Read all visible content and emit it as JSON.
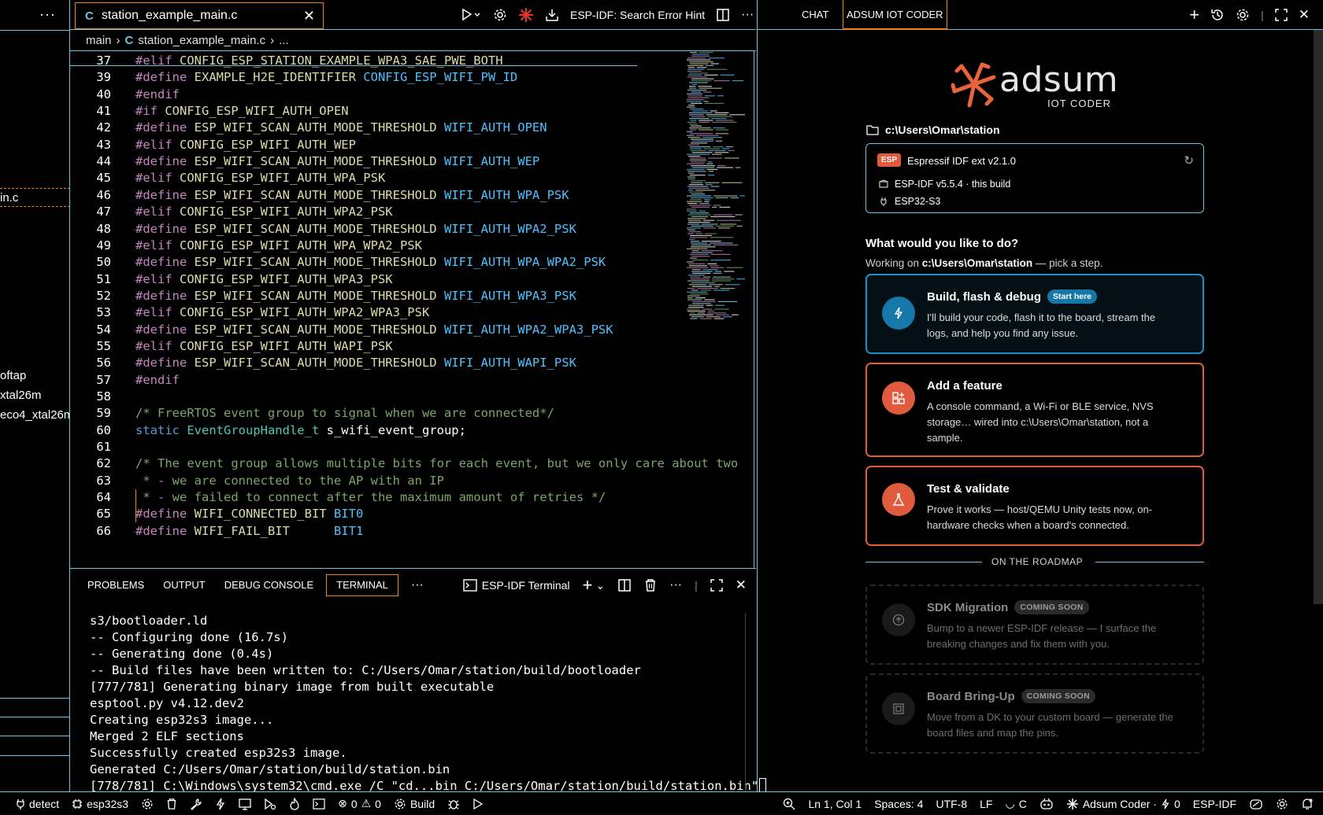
{
  "sidebar": {
    "items": [
      {
        "label": "in.c",
        "active": true
      },
      {
        "label": "oftap"
      },
      {
        "label": "xtal26m"
      },
      {
        "label": "eco4_xtal26m"
      }
    ]
  },
  "editor": {
    "tab": {
      "lang_badge": "C",
      "filename": "station_example_main.c"
    },
    "toolbar": {
      "search_error_hint": "ESP-IDF: Search Error Hint"
    },
    "breadcrumb": {
      "folder": "main",
      "file": "station_example_main.c",
      "more": "..."
    },
    "lines": [
      {
        "n": "37",
        "tokens": [
          [
            "pp",
            "#elif "
          ],
          [
            "id",
            "CONFIG_ESP_STATION_EXAMPLE_WPA3_SAE_PWE_BOTH"
          ]
        ]
      },
      {
        "n": "39",
        "tokens": [
          [
            "pp",
            "#define "
          ],
          [
            "id",
            "EXAMPLE_H2E_IDENTIFIER "
          ],
          [
            "mac",
            "CONFIG_ESP_WIFI_PW_ID"
          ]
        ]
      },
      {
        "n": "40",
        "tokens": [
          [
            "pp",
            "#endif"
          ]
        ]
      },
      {
        "n": "41",
        "tokens": [
          [
            "pp",
            "#if "
          ],
          [
            "id",
            "CONFIG_ESP_WIFI_AUTH_OPEN"
          ]
        ]
      },
      {
        "n": "42",
        "tokens": [
          [
            "pp",
            "#define "
          ],
          [
            "id",
            "ESP_WIFI_SCAN_AUTH_MODE_THRESHOLD "
          ],
          [
            "mac",
            "WIFI_AUTH_OPEN"
          ]
        ]
      },
      {
        "n": "43",
        "tokens": [
          [
            "pp",
            "#elif "
          ],
          [
            "id",
            "CONFIG_ESP_WIFI_AUTH_WEP"
          ]
        ]
      },
      {
        "n": "44",
        "tokens": [
          [
            "pp",
            "#define "
          ],
          [
            "id",
            "ESP_WIFI_SCAN_AUTH_MODE_THRESHOLD "
          ],
          [
            "mac",
            "WIFI_AUTH_WEP"
          ]
        ]
      },
      {
        "n": "45",
        "tokens": [
          [
            "pp",
            "#elif "
          ],
          [
            "id",
            "CONFIG_ESP_WIFI_AUTH_WPA_PSK"
          ]
        ]
      },
      {
        "n": "46",
        "tokens": [
          [
            "pp",
            "#define "
          ],
          [
            "id",
            "ESP_WIFI_SCAN_AUTH_MODE_THRESHOLD "
          ],
          [
            "mac",
            "WIFI_AUTH_WPA_PSK"
          ]
        ]
      },
      {
        "n": "47",
        "tokens": [
          [
            "pp",
            "#elif "
          ],
          [
            "id",
            "CONFIG_ESP_WIFI_AUTH_WPA2_PSK"
          ]
        ]
      },
      {
        "n": "48",
        "tokens": [
          [
            "pp",
            "#define "
          ],
          [
            "id",
            "ESP_WIFI_SCAN_AUTH_MODE_THRESHOLD "
          ],
          [
            "mac",
            "WIFI_AUTH_WPA2_PSK"
          ]
        ]
      },
      {
        "n": "49",
        "tokens": [
          [
            "pp",
            "#elif "
          ],
          [
            "id",
            "CONFIG_ESP_WIFI_AUTH_WPA_WPA2_PSK"
          ]
        ]
      },
      {
        "n": "50",
        "tokens": [
          [
            "pp",
            "#define "
          ],
          [
            "id",
            "ESP_WIFI_SCAN_AUTH_MODE_THRESHOLD "
          ],
          [
            "mac",
            "WIFI_AUTH_WPA_WPA2_PSK"
          ]
        ]
      },
      {
        "n": "51",
        "tokens": [
          [
            "pp",
            "#elif "
          ],
          [
            "id",
            "CONFIG_ESP_WIFI_AUTH_WPA3_PSK"
          ]
        ]
      },
      {
        "n": "52",
        "tokens": [
          [
            "pp",
            "#define "
          ],
          [
            "id",
            "ESP_WIFI_SCAN_AUTH_MODE_THRESHOLD "
          ],
          [
            "mac",
            "WIFI_AUTH_WPA3_PSK"
          ]
        ]
      },
      {
        "n": "53",
        "tokens": [
          [
            "pp",
            "#elif "
          ],
          [
            "id",
            "CONFIG_ESP_WIFI_AUTH_WPA2_WPA3_PSK"
          ]
        ]
      },
      {
        "n": "54",
        "tokens": [
          [
            "pp",
            "#define "
          ],
          [
            "id",
            "ESP_WIFI_SCAN_AUTH_MODE_THRESHOLD "
          ],
          [
            "mac",
            "WIFI_AUTH_WPA2_WPA3_PSK"
          ]
        ]
      },
      {
        "n": "55",
        "tokens": [
          [
            "pp",
            "#elif "
          ],
          [
            "id",
            "CONFIG_ESP_WIFI_AUTH_WAPI_PSK"
          ]
        ]
      },
      {
        "n": "56",
        "tokens": [
          [
            "pp",
            "#define "
          ],
          [
            "id",
            "ESP_WIFI_SCAN_AUTH_MODE_THRESHOLD "
          ],
          [
            "mac",
            "WIFI_AUTH_WAPI_PSK"
          ]
        ]
      },
      {
        "n": "57",
        "tokens": [
          [
            "pp",
            "#endif"
          ]
        ]
      },
      {
        "n": "58",
        "tokens": []
      },
      {
        "n": "59",
        "tokens": [
          [
            "cm",
            "/* FreeRTOS event group to signal when we are connected*/"
          ]
        ]
      },
      {
        "n": "60",
        "tokens": [
          [
            "kw",
            "static "
          ],
          [
            "ty",
            "EventGroupHandle_t "
          ],
          [
            "pl",
            "s_wifi_event_group;"
          ]
        ]
      },
      {
        "n": "61",
        "tokens": []
      },
      {
        "n": "62",
        "tokens": [
          [
            "cm",
            "/* The event group allows multiple bits for each event, but we only care about two"
          ]
        ]
      },
      {
        "n": "63",
        "tokens": [
          [
            "cm",
            " * - we are connected to the AP with an IP"
          ]
        ]
      },
      {
        "n": "64",
        "tokens": [
          [
            "cm",
            " * - we failed to connect after the maximum amount of retries */"
          ]
        ]
      },
      {
        "n": "65",
        "tokens": [
          [
            "pp",
            "#define "
          ],
          [
            "id",
            "WIFI_CONNECTED_BIT "
          ],
          [
            "mac",
            "BIT0"
          ]
        ]
      },
      {
        "n": "66",
        "tokens": [
          [
            "pp",
            "#define "
          ],
          [
            "id",
            "WIFI_FAIL_BIT      "
          ],
          [
            "mac",
            "BIT1"
          ]
        ]
      }
    ]
  },
  "panel": {
    "tabs": [
      "PROBLEMS",
      "OUTPUT",
      "DEBUG CONSOLE",
      "TERMINAL"
    ],
    "active_tab": "TERMINAL",
    "terminal_name": "ESP-IDF Terminal",
    "terminal_lines": [
      "s3/bootloader.ld",
      "-- Configuring done (16.7s)",
      "-- Generating done (0.4s)",
      "-- Build files have been written to: C:/Users/Omar/station/build/bootloader",
      "[777/781] Generating binary image from built executable",
      "esptool.py v4.12.dev2",
      "Creating esp32s3 image...",
      "Merged 2 ELF sections",
      "Successfully created esp32s3 image.",
      "Generated C:/Users/Omar/station/build/station.bin",
      "[778/781] C:\\Windows\\system32\\cmd.exe /C \"cd...bin C:/Users/Omar/station/build/station.bin\""
    ]
  },
  "chat": {
    "tabs": [
      "CHAT",
      "ADSUM IOT CODER"
    ],
    "active_tab": "ADSUM IOT CODER",
    "logo_word": "adsum",
    "logo_sub": "IOT CODER",
    "path": "c:\\Users\\Omar\\station",
    "info": {
      "badge": "ESP",
      "ext": "Espressif IDF ext v2.1.0",
      "idf": "ESP-IDF v5.5.4 · this build",
      "target": "ESP32-S3"
    },
    "question": "What would you like to do?",
    "working_prefix": "Working on ",
    "working_path": "c:\\Users\\Omar\\station",
    "working_suffix": " — pick a step.",
    "cards": [
      {
        "title": "Build, flash & debug",
        "pill": "Start here",
        "desc": "I'll build your code, flash it to the board, stream the logs, and help you find any issue.",
        "icon": "bolt-icon"
      },
      {
        "title": "Add a feature",
        "desc": "A console command, a Wi-Fi or BLE service, NVS storage… wired into c:\\Users\\Omar\\station, not a sample.",
        "icon": "grid-plus-icon"
      },
      {
        "title": "Test & validate",
        "desc": "Prove it works — host/QEMU Unity tests now, on-hardware checks when a board's connected.",
        "icon": "flask-icon"
      }
    ],
    "roadmap_label": "ON THE ROADMAP",
    "roadmap": [
      {
        "title": "SDK Migration",
        "pill": "COMING SOON",
        "desc": "Bump to a newer ESP-IDF release — I surface the breaking changes and fix them with you.",
        "icon": "upgrade-icon"
      },
      {
        "title": "Board Bring-Up",
        "pill": "COMING SOON",
        "desc": "Move from a DK to your custom board — generate the board files and map the pins.",
        "icon": "chip-icon"
      }
    ],
    "accent_colors": {
      "blue": "#1a8fc4",
      "orange": "#e05a3d"
    }
  },
  "status": {
    "detect": "detect",
    "target": "esp32s3",
    "errors": "0",
    "warnings": "0",
    "build": "Build",
    "position": "Ln 1, Col 1",
    "spaces": "Spaces: 4",
    "encoding": "UTF-8",
    "eol": "LF",
    "language": "C",
    "coder": "Adsum Coder ·",
    "coder_count": "0",
    "idf": "ESP-IDF"
  }
}
